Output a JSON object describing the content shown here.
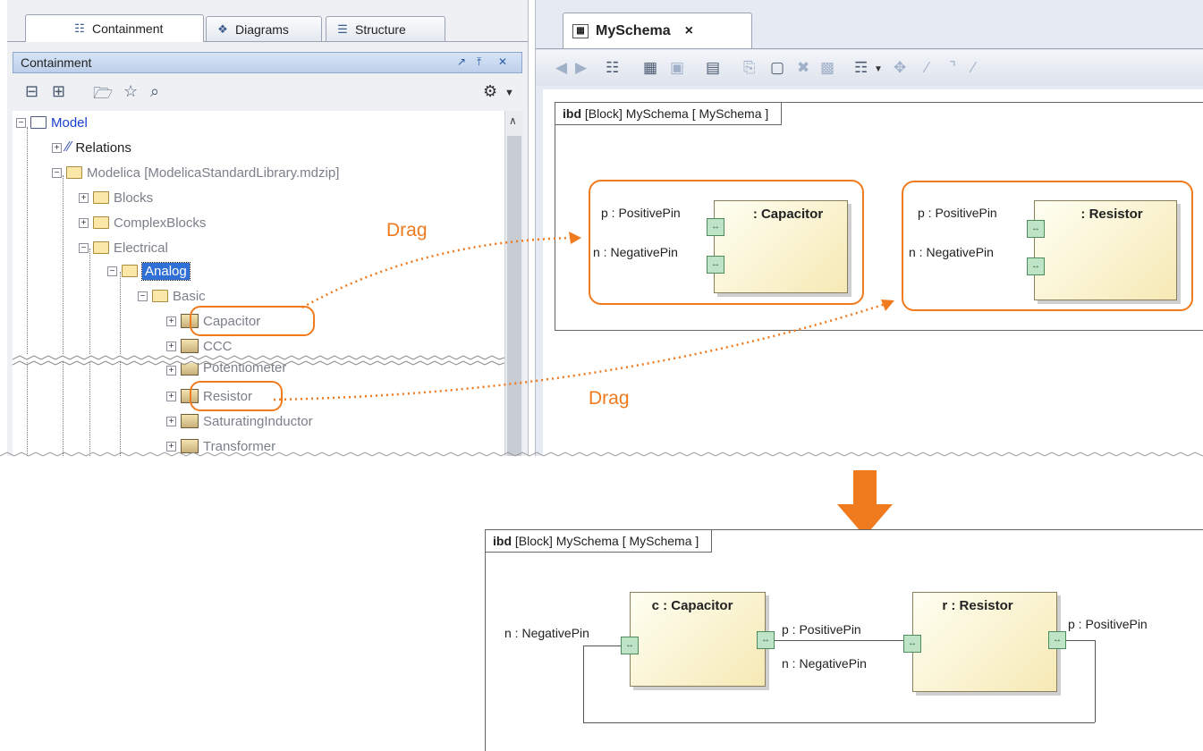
{
  "left_panel": {
    "tabs": [
      {
        "label": "Containment",
        "icon": "containment-icon"
      },
      {
        "label": "Diagrams",
        "icon": "diagrams-icon"
      },
      {
        "label": "Structure",
        "icon": "structure-icon"
      }
    ],
    "panel_title": "Containment",
    "tree": [
      {
        "label": "Model"
      },
      {
        "label": "Relations"
      },
      {
        "label": "Modelica [ModelicaStandardLibrary.mdzip]"
      },
      {
        "label": "Blocks"
      },
      {
        "label": "ComplexBlocks"
      },
      {
        "label": "Electrical"
      },
      {
        "label": "Analog"
      },
      {
        "label": "Basic"
      },
      {
        "label": "Capacitor"
      },
      {
        "label": "CCC"
      },
      {
        "label": "Potentiometer"
      },
      {
        "label": "Resistor"
      },
      {
        "label": "SaturatingInductor"
      },
      {
        "label": "Transformer"
      }
    ]
  },
  "editor": {
    "tab_label": "MySchema",
    "close_glyph": "×"
  },
  "top_diagram": {
    "frame_kind": "ibd",
    "frame_title": "[Block] MySchema [ MySchema ]",
    "capacitor": {
      "name": ": Capacitor",
      "p_port": "p : PositivePin",
      "n_port": "n : NegativePin"
    },
    "resistor": {
      "name": ": Resistor",
      "p_port": "p : PositivePin",
      "n_port": "n : NegativePin"
    }
  },
  "drag_labels": [
    "Drag",
    "Drag"
  ],
  "bottom_diagram": {
    "frame_kind": "ibd",
    "frame_title": "[Block] MySchema [ MySchema ]",
    "capacitor": {
      "name": "c : Capacitor",
      "n_port": "n : NegativePin",
      "p_port": "p : PositivePin"
    },
    "resistor": {
      "name": "r : Resistor",
      "n_port": "n : NegativePin",
      "p_port": "p : PositivePin"
    }
  },
  "colors": {
    "accent": "#f07a1e",
    "selection": "#2f6fd6"
  }
}
